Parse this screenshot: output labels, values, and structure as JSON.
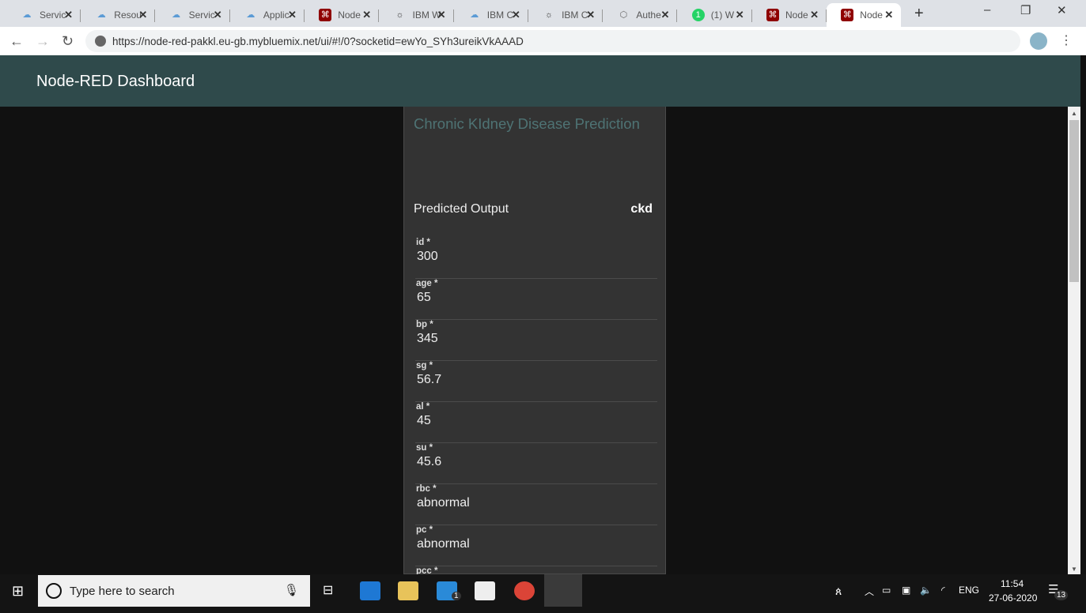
{
  "browser": {
    "tabs": [
      {
        "label": "Servic",
        "icon": "cloud-icon"
      },
      {
        "label": "Resou",
        "icon": "cloud-icon"
      },
      {
        "label": "Servic",
        "icon": "cloud-icon"
      },
      {
        "label": "Applic",
        "icon": "cloud-icon"
      },
      {
        "label": "Node",
        "icon": "node-red-icon"
      },
      {
        "label": "IBM W",
        "icon": "watson-icon"
      },
      {
        "label": "IBM C",
        "icon": "cloud-icon"
      },
      {
        "label": "IBM C",
        "icon": "watson-icon"
      },
      {
        "label": "Authe",
        "icon": "hex-icon"
      },
      {
        "label": "(1) W",
        "icon": "whatsapp-icon"
      },
      {
        "label": "Node",
        "icon": "node-red-icon"
      },
      {
        "label": "Node",
        "icon": "node-red-icon",
        "active": true
      }
    ],
    "new_tab": "+",
    "url": "https://node-red-pakkl.eu-gb.mybluemix.net/ui/#!/0?socketid=ewYo_SYh3ureikVkAAAD"
  },
  "header": {
    "title": "Node-RED Dashboard"
  },
  "card": {
    "title": "Chronic KIdney Disease Prediction",
    "output_label": "Predicted Output",
    "output_value": "ckd",
    "fields": [
      {
        "label": "id *",
        "value": "300"
      },
      {
        "label": "age *",
        "value": "65"
      },
      {
        "label": "bp *",
        "value": "345"
      },
      {
        "label": "sg *",
        "value": "56.7"
      },
      {
        "label": "al *",
        "value": "45"
      },
      {
        "label": "su *",
        "value": "45.6"
      },
      {
        "label": "rbc *",
        "value": "abnormal"
      },
      {
        "label": "pc *",
        "value": "abnormal"
      },
      {
        "label": "pcc *",
        "value": ""
      }
    ]
  },
  "taskbar": {
    "search_placeholder": "Type here to search",
    "mail_badge": "1",
    "language": "ENG",
    "time": "11:54",
    "date": "27-06-2020",
    "notifications": "13"
  }
}
